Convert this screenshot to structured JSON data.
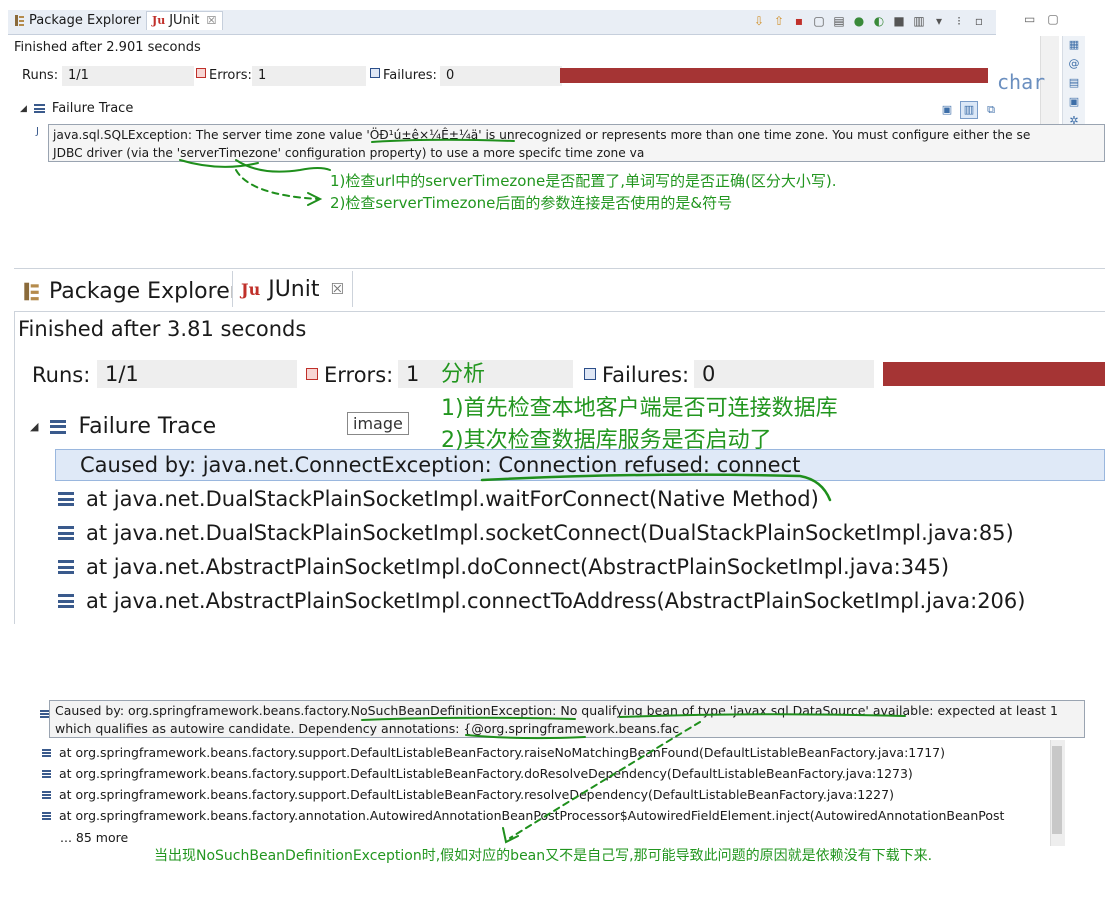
{
  "panel1": {
    "tabs": [
      {
        "label": "Package Explorer",
        "icon": "package-explorer-icon"
      },
      {
        "label": "JUnit",
        "icon": "junit-icon",
        "close": "☒"
      }
    ],
    "finished": "Finished after 2.901 seconds",
    "runs_label": "Runs:",
    "runs_value": "1/1",
    "errors_label": "Errors:",
    "errors_value": "1",
    "failures_label": "Failures:",
    "failures_value": "0",
    "editor_fragment": "char",
    "failure_trace_label": "Failure Trace",
    "tooltip_line1": "java.sql.SQLException: The server time zone value 'ÖÐ¹ú±ê×¼Ê±¼ä' is unrecognized or represents more than one time zone. You must configure either the se",
    "tooltip_line2": "JDBC driver (via the 'serverTimezone' configuration property) to use a more specifc time zone va",
    "note1": "1)检查url中的serverTimezone是否配置了,单词写的是否正确(区分大小写).",
    "note2": "2)检查serverTimezone后面的参数连接是否使用的是&符号"
  },
  "panel2": {
    "tabs": [
      {
        "label": "Package Explorer",
        "icon": "package-explorer-icon"
      },
      {
        "label": "JUnit",
        "icon": "junit-icon",
        "close": "☒"
      }
    ],
    "finished": "Finished after 3.81 seconds",
    "runs_label": "Runs:",
    "runs_value": "1/1",
    "errors_label": "Errors:",
    "errors_value": "1",
    "failures_label": "Failures:",
    "failures_value": "0",
    "failure_trace_label": "Failure Trace",
    "image_tooltip": "image",
    "selected_row": "Caused by: java.net.ConnectException: Connection refused: connect",
    "trace": [
      "at java.net.DualStackPlainSocketImpl.waitForConnect(Native Method)",
      "at java.net.DualStackPlainSocketImpl.socketConnect(DualStackPlainSocketImpl.java:85)",
      "at java.net.AbstractPlainSocketImpl.doConnect(AbstractPlainSocketImpl.java:345)",
      "at java.net.AbstractPlainSocketImpl.connectToAddress(AbstractPlainSocketImpl.java:206)"
    ],
    "note_title": "分析",
    "note1": "1)首先检查本地客户端是否可连接数据库",
    "note2": "2)其次检查数据库服务是否启动了"
  },
  "panel3": {
    "tooltip_line1": "Caused by: org.springframework.beans.factory.NoSuchBeanDefinitionException: No qualifying bean of type 'javax.sql.DataSource' available: expected at least 1",
    "tooltip_line2": "which qualifies as autowire candidate. Dependency annotations: {@org.springframework.beans.fac",
    "trace": [
      "at org.springframework.beans.factory.support.DefaultListableBeanFactory.raiseNoMatchingBeanFound(DefaultListableBeanFactory.java:1717)",
      "at org.springframework.beans.factory.support.DefaultListableBeanFactory.doResolveDependency(DefaultListableBeanFactory.java:1273)",
      "at org.springframework.beans.factory.support.DefaultListableBeanFactory.resolveDependency(DefaultListableBeanFactory.java:1227)",
      "at org.springframework.beans.factory.annotation.AutowiredAnnotationBeanPostProcessor$AutowiredFieldElement.inject(AutowiredAnnotationBeanPost"
    ],
    "more": "... 85 more",
    "note": "当出现NoSuchBeanDefinitionException时,假如对应的bean又不是自己写,那可能导致此问题的原因就是依赖没有下载下来."
  },
  "colors": {
    "annotation_green": "#22961f",
    "progress_error_red": "#a53434",
    "selection_blue": "#dfe9f7"
  }
}
